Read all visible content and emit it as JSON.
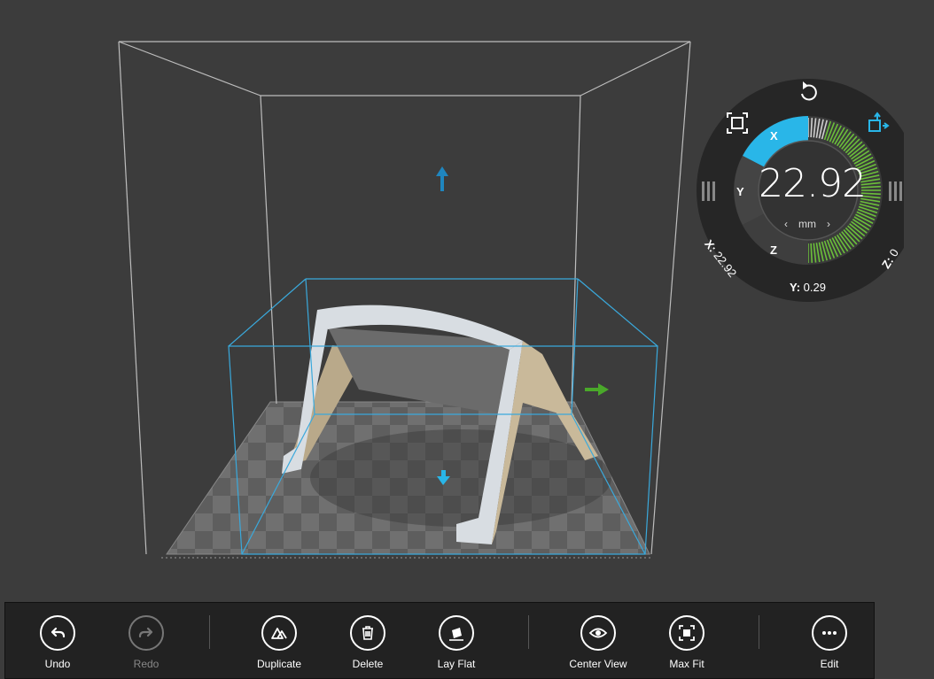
{
  "gizmo": {
    "value": "22.92",
    "unit": "mm",
    "unit_prev": "‹",
    "unit_next": "›",
    "axes": {
      "x": "X",
      "y": "Y",
      "z": "Z"
    },
    "readouts": {
      "x": {
        "label": "X:",
        "value": "22.92"
      },
      "y": {
        "label": "Y:",
        "value": "0.29"
      },
      "z": {
        "label": "Z:",
        "value": "0"
      }
    },
    "icons": {
      "rotate": "rotate-icon",
      "scale": "scale-icon",
      "move": "move-icon",
      "left_handle": "drag-handle-icon",
      "right_handle": "drag-handle-icon"
    },
    "colors": {
      "active": "#29b6e8",
      "dial": "#6bbf3a",
      "ring": "#2a2a2a"
    }
  },
  "toolbar": {
    "undo": {
      "label": "Undo",
      "icon": "undo-icon"
    },
    "redo": {
      "label": "Redo",
      "icon": "redo-icon"
    },
    "duplicate": {
      "label": "Duplicate",
      "icon": "duplicate-icon"
    },
    "delete": {
      "label": "Delete",
      "icon": "trash-icon"
    },
    "lay_flat": {
      "label": "Lay Flat",
      "icon": "lay-flat-icon"
    },
    "center_view": {
      "label": "Center View",
      "icon": "eye-icon"
    },
    "max_fit": {
      "label": "Max Fit",
      "icon": "max-fit-icon"
    },
    "edit": {
      "label": "Edit",
      "icon": "more-icon"
    }
  },
  "scene": {
    "colors": {
      "background": "#3c3c3c",
      "build_volume": "#bdbdbd",
      "bounding_box": "#3aa9dc",
      "up_arrow": "#1f86bf",
      "right_arrow": "#4aa82a",
      "down_arrow": "#29b6e8",
      "model": "#c9b99a"
    }
  }
}
